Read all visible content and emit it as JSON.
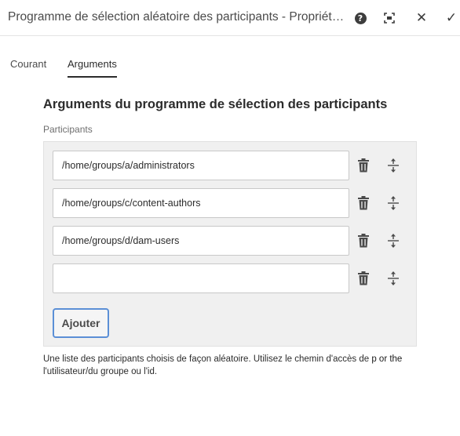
{
  "header": {
    "title": "Programme de sélection aléatoire des participants - Propriétés des éta...",
    "help_icon": "help-icon",
    "fullscreen_icon": "fullscreen-icon",
    "close_glyph": "✕",
    "done_glyph": "✓"
  },
  "tabs": [
    {
      "label": "Courant",
      "selected": false
    },
    {
      "label": "Arguments",
      "selected": true
    }
  ],
  "section": {
    "title": "Arguments du programme de sélection des participants",
    "field_label": "Participants"
  },
  "participants": [
    {
      "value": "/home/groups/a/administrators"
    },
    {
      "value": "/home/groups/c/content-authors"
    },
    {
      "value": "/home/groups/d/dam-users"
    },
    {
      "value": ""
    }
  ],
  "add_button": "Ajouter",
  "description": {
    "text": "Une liste des participants choisis de façon aléatoire. Utilisez le chemin d'accès de ",
    "link": "p or the",
    "text2": "l'utilisateur/du groupe ou l'id."
  },
  "colors": {
    "accent_border": "#5b8fd6",
    "panel_bg": "#f0f0f0"
  }
}
